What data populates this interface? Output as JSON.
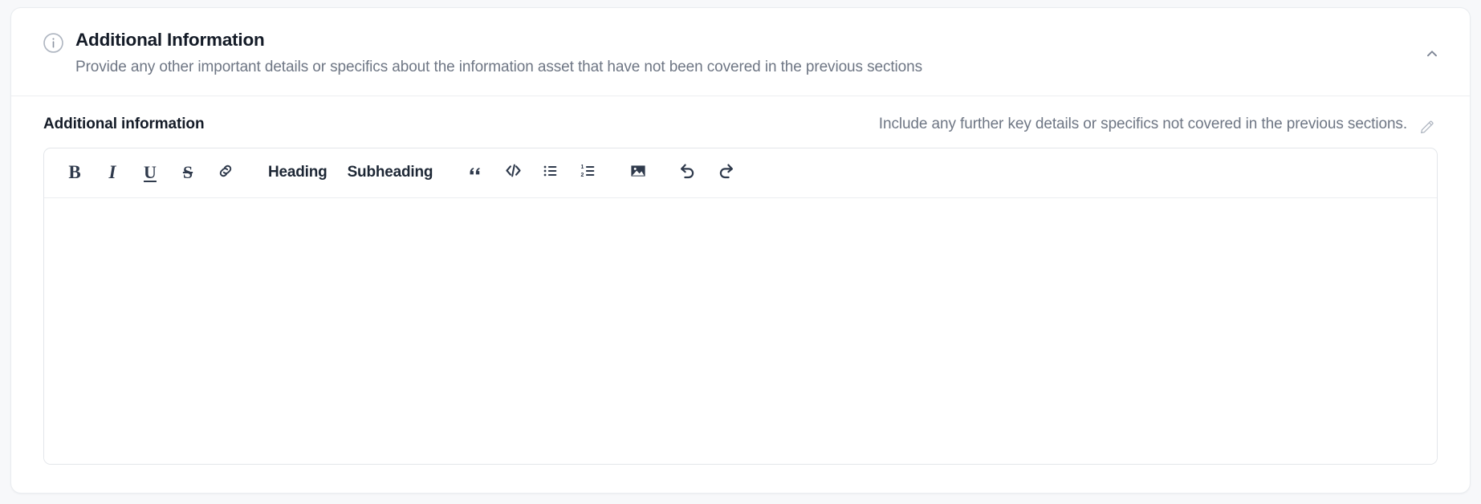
{
  "section": {
    "icon": "info-circle-icon",
    "title": "Additional Information",
    "description": "Provide any other important details or specifics about the information asset that have not been covered in the previous sections",
    "collapse_icon": "chevron-up-icon",
    "expanded": true
  },
  "field": {
    "label": "Additional information",
    "hint": "Include any further key details or specifics not covered in the previous sections.",
    "edit_icon": "pencil-icon",
    "value": "",
    "placeholder": ""
  },
  "toolbar": {
    "items": [
      {
        "name": "bold-button",
        "label": "B",
        "icon": "bold-icon"
      },
      {
        "name": "italic-button",
        "label": "I",
        "icon": "italic-icon"
      },
      {
        "name": "underline-button",
        "label": "U",
        "icon": "underline-icon"
      },
      {
        "name": "strikethrough-button",
        "label": "S",
        "icon": "strikethrough-icon"
      },
      {
        "name": "link-button",
        "label": "",
        "icon": "link-icon"
      },
      {
        "name": "heading-button",
        "label": "Heading",
        "icon": "heading-text"
      },
      {
        "name": "subheading-button",
        "label": "Subheading",
        "icon": "subheading-text"
      },
      {
        "name": "blockquote-button",
        "label": "“",
        "icon": "quote-icon"
      },
      {
        "name": "code-block-button",
        "label": "",
        "icon": "code-icon"
      },
      {
        "name": "bullet-list-button",
        "label": "",
        "icon": "bullet-list-icon"
      },
      {
        "name": "numbered-list-button",
        "label": "",
        "icon": "numbered-list-icon"
      },
      {
        "name": "insert-image-button",
        "label": "",
        "icon": "image-icon"
      },
      {
        "name": "undo-button",
        "label": "",
        "icon": "undo-icon"
      },
      {
        "name": "redo-button",
        "label": "",
        "icon": "redo-icon"
      }
    ],
    "heading_label": "Heading",
    "subheading_label": "Subheading"
  },
  "colors": {
    "page_background": "#f7f8fa",
    "card_background": "#ffffff",
    "card_border": "#e9ecef",
    "title_text": "#141b27",
    "muted_text": "#6e7684",
    "toolbar_icon": "#2f3a4c",
    "field_border": "#e3e6ea"
  }
}
